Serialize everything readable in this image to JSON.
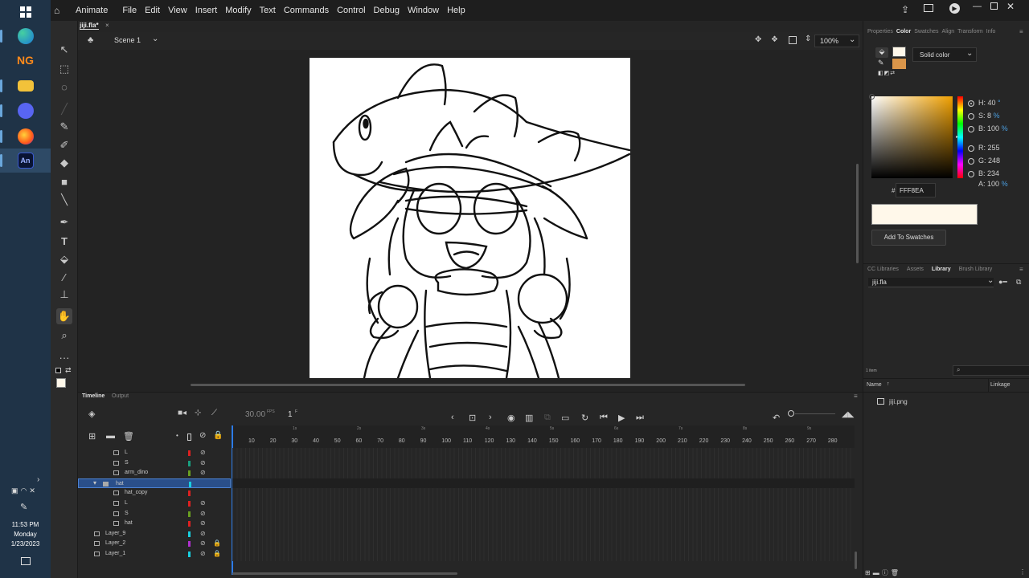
{
  "taskbar": {
    "apps": [
      {
        "name": "windows-start",
        "label": "⊞"
      },
      {
        "name": "edge",
        "label": "e"
      },
      {
        "name": "newgrounds",
        "label": "NG"
      },
      {
        "name": "file-explorer",
        "label": "▆"
      },
      {
        "name": "discord",
        "label": "◕"
      },
      {
        "name": "firefox",
        "label": "◐"
      },
      {
        "name": "animate",
        "label": "An"
      }
    ],
    "time": "11:53 PM",
    "day": "Monday",
    "date": "1/23/2023"
  },
  "menubar": {
    "app_name": "Animate",
    "items": [
      "File",
      "Edit",
      "View",
      "Insert",
      "Modify",
      "Text",
      "Commands",
      "Control",
      "Debug",
      "Window",
      "Help"
    ]
  },
  "document": {
    "tab": "jiji.fla*"
  },
  "scenebar": {
    "scene": "Scene 1",
    "zoom": "100%"
  },
  "timeline": {
    "tabs": [
      "Timeline",
      "Output"
    ],
    "fps": "30.00",
    "fps_unit": "FPS",
    "frame": "1",
    "frame_unit": "F",
    "seconds": [
      "1s",
      "2s",
      "3s",
      "4s",
      "5s",
      "6s",
      "7s",
      "8s",
      "9s"
    ],
    "frames": [
      "10",
      "20",
      "30",
      "40",
      "50",
      "60",
      "70",
      "80",
      "90",
      "100",
      "110",
      "120",
      "130",
      "140",
      "150",
      "160",
      "170",
      "180",
      "190",
      "200",
      "210",
      "220",
      "230",
      "240",
      "250",
      "260",
      "270",
      "280"
    ],
    "layers": [
      {
        "name": "L",
        "indent": 2,
        "color": "#e02020",
        "hidden": true,
        "locked": false,
        "selected": false,
        "folder": false
      },
      {
        "name": "S",
        "indent": 2,
        "color": "#18a080",
        "hidden": true,
        "locked": false,
        "selected": false,
        "folder": false
      },
      {
        "name": "arm_dino",
        "indent": 2,
        "color": "#6aa020",
        "hidden": true,
        "locked": false,
        "selected": false,
        "folder": false
      },
      {
        "name": "hat",
        "indent": 1,
        "color": "#18d0e0",
        "hidden": false,
        "locked": false,
        "selected": true,
        "folder": true
      },
      {
        "name": "hat_copy",
        "indent": 2,
        "color": "#e02020",
        "hidden": false,
        "locked": false,
        "selected": false,
        "folder": false
      },
      {
        "name": "L",
        "indent": 2,
        "color": "#e02020",
        "hidden": true,
        "locked": false,
        "selected": false,
        "folder": false
      },
      {
        "name": "S",
        "indent": 2,
        "color": "#6aa020",
        "hidden": true,
        "locked": false,
        "selected": false,
        "folder": false
      },
      {
        "name": "hat",
        "indent": 2,
        "color": "#e02020",
        "hidden": true,
        "locked": false,
        "selected": false,
        "folder": false
      },
      {
        "name": "Layer_9",
        "indent": 0,
        "color": "#18d0e0",
        "hidden": true,
        "locked": false,
        "selected": false,
        "folder": false
      },
      {
        "name": "Layer_2",
        "indent": 0,
        "color": "#b030d0",
        "hidden": true,
        "locked": true,
        "selected": false,
        "folder": false
      },
      {
        "name": "Layer_1",
        "indent": 0,
        "color": "#18d0e0",
        "hidden": true,
        "locked": true,
        "selected": false,
        "folder": false
      }
    ]
  },
  "color_panel": {
    "tabs": [
      "Properties",
      "Color",
      "Swatches",
      "Align",
      "Transform",
      "Info"
    ],
    "active_tab": "Color",
    "fill_type": "Solid color",
    "fill_swatch": "#FFF8EA",
    "stroke_swatch": "#D9954A",
    "H": "40",
    "H_unit": "°",
    "S": "8",
    "S_unit": "%",
    "B": "100",
    "B_unit": "%",
    "R": "255",
    "G": "248",
    "Bl": "234",
    "A": "100",
    "A_unit": "%",
    "hex_label": "#",
    "hex": "FFF8EA",
    "add_swatch": "Add To Swatches",
    "hue_color": "#f0a000"
  },
  "library_panel": {
    "tabs": [
      "CC Libraries",
      "Assets",
      "Library",
      "Brush Library"
    ],
    "active_tab": "Library",
    "file": "jiji.fla",
    "count": "1 item",
    "col_name": "Name",
    "col_linkage": "Linkage",
    "items": [
      "jiji.png"
    ]
  }
}
